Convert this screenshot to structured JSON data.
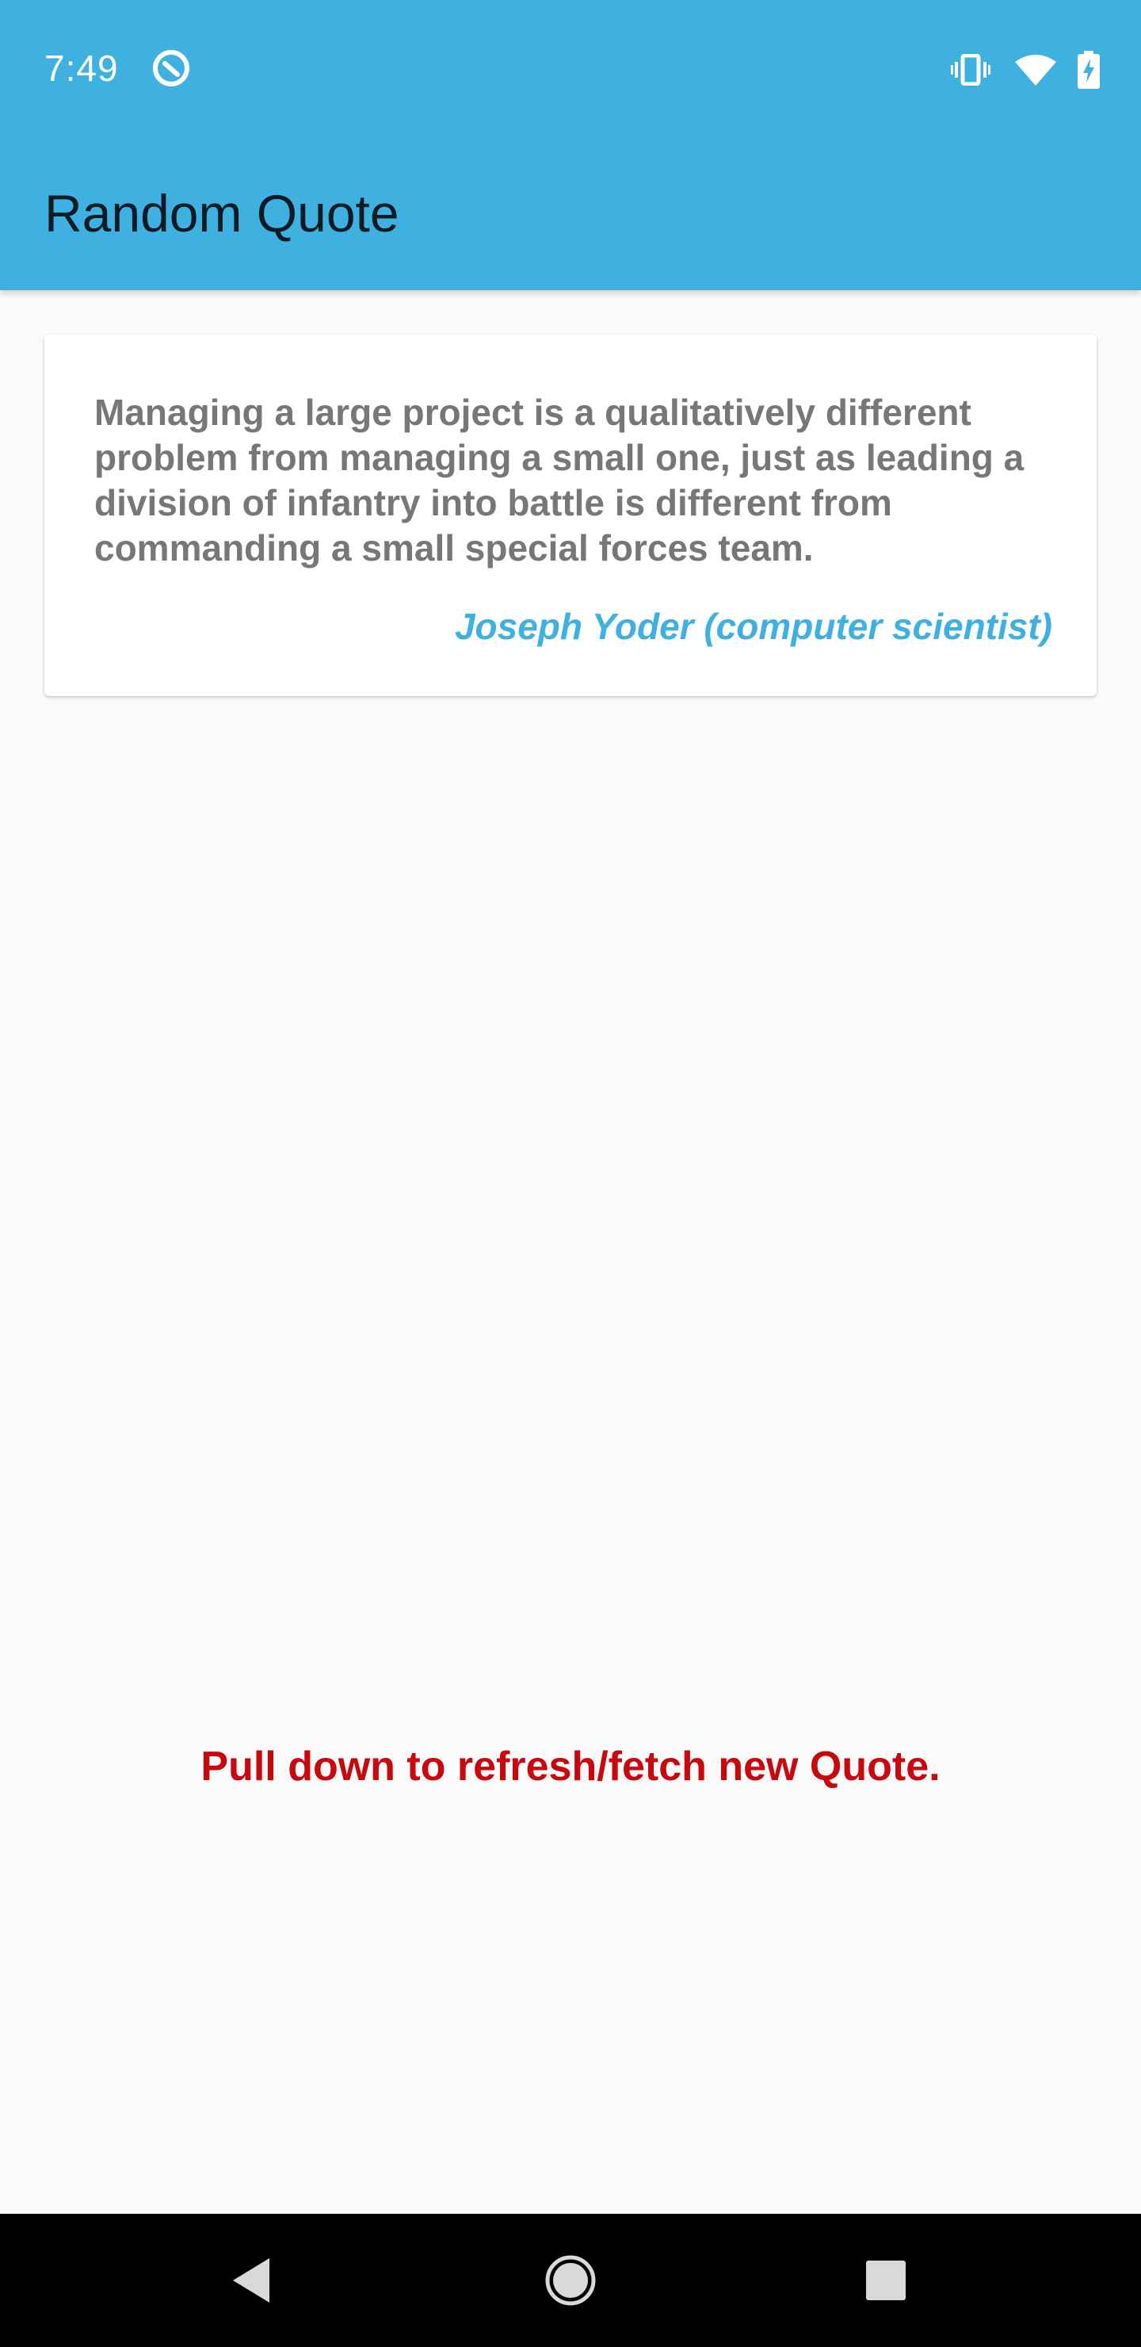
{
  "status_bar": {
    "time": "7:49",
    "icons": [
      "app-notification-icon",
      "vibrate-icon",
      "wifi-icon",
      "battery-charging-icon"
    ]
  },
  "app_bar": {
    "title": "Random Quote",
    "color": "#3eb1e0"
  },
  "quote": {
    "text": "Managing a large project is a qualitatively different problem from managing a small one, just as leading a division of infantry into battle is different from commanding a small special forces team.",
    "author": "Joseph Yoder (computer scientist)",
    "text_color": "#777777",
    "author_color": "#3eb1e0"
  },
  "hint": {
    "text": "Pull down to refresh/fetch new Quote.",
    "color": "#c8070f"
  },
  "nav_bar": {
    "icons": [
      "back-icon",
      "home-icon",
      "recents-icon"
    ]
  }
}
